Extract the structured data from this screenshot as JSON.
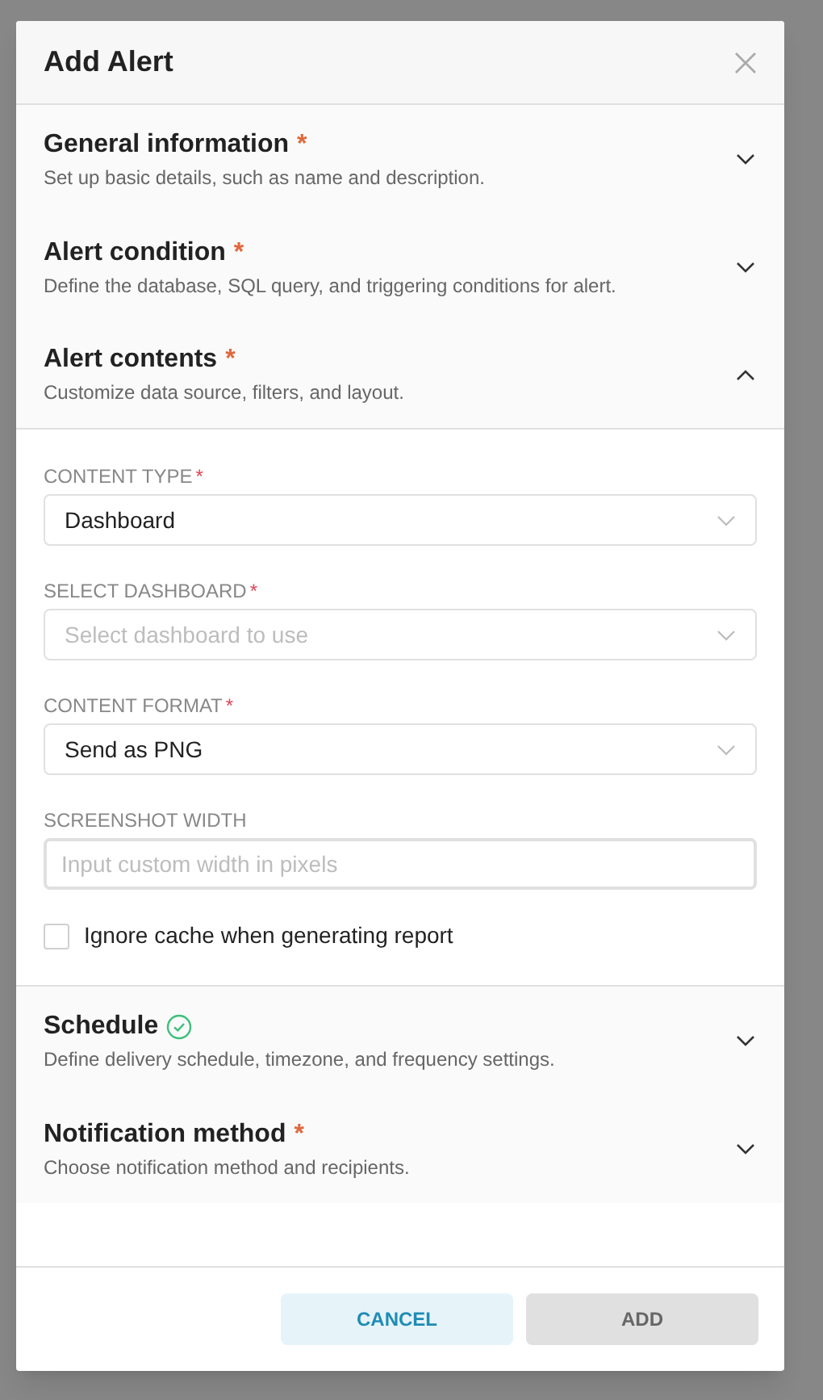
{
  "dialog": {
    "title": "Add Alert",
    "sections": [
      {
        "title": "General information",
        "required_mark": "*",
        "description": "Set up basic details, such as name and description.",
        "expanded": false
      },
      {
        "title": "Alert condition",
        "required_mark": "*",
        "description": "Define the database, SQL query, and triggering conditions for alert.",
        "expanded": false
      },
      {
        "title": "Alert contents",
        "required_mark": "*",
        "description": "Customize data source, filters, and layout.",
        "expanded": true,
        "fields": [
          {
            "kind": "select",
            "label": "CONTENT TYPE",
            "required_mark": "*",
            "value": "Dashboard"
          },
          {
            "kind": "select",
            "label": "SELECT DASHBOARD",
            "required_mark": "*",
            "placeholder": "Select dashboard to use"
          },
          {
            "kind": "select",
            "label": "CONTENT FORMAT",
            "required_mark": "*",
            "value": "Send as PNG"
          },
          {
            "kind": "input",
            "label": "SCREENSHOT WIDTH",
            "placeholder": "Input custom width in pixels"
          },
          {
            "kind": "checkbox",
            "label": "Ignore cache when generating report",
            "checked": false
          }
        ]
      },
      {
        "title": "Schedule",
        "complete": true,
        "description": "Define delivery schedule, timezone, and frequency settings.",
        "expanded": false
      },
      {
        "title": "Notification method",
        "required_mark": "*",
        "description": "Choose notification method and recipients.",
        "expanded": false
      }
    ],
    "buttons": [
      {
        "label": "CANCEL",
        "kind": "secondary"
      },
      {
        "label": "ADD",
        "kind": "primary",
        "disabled": true
      }
    ]
  }
}
